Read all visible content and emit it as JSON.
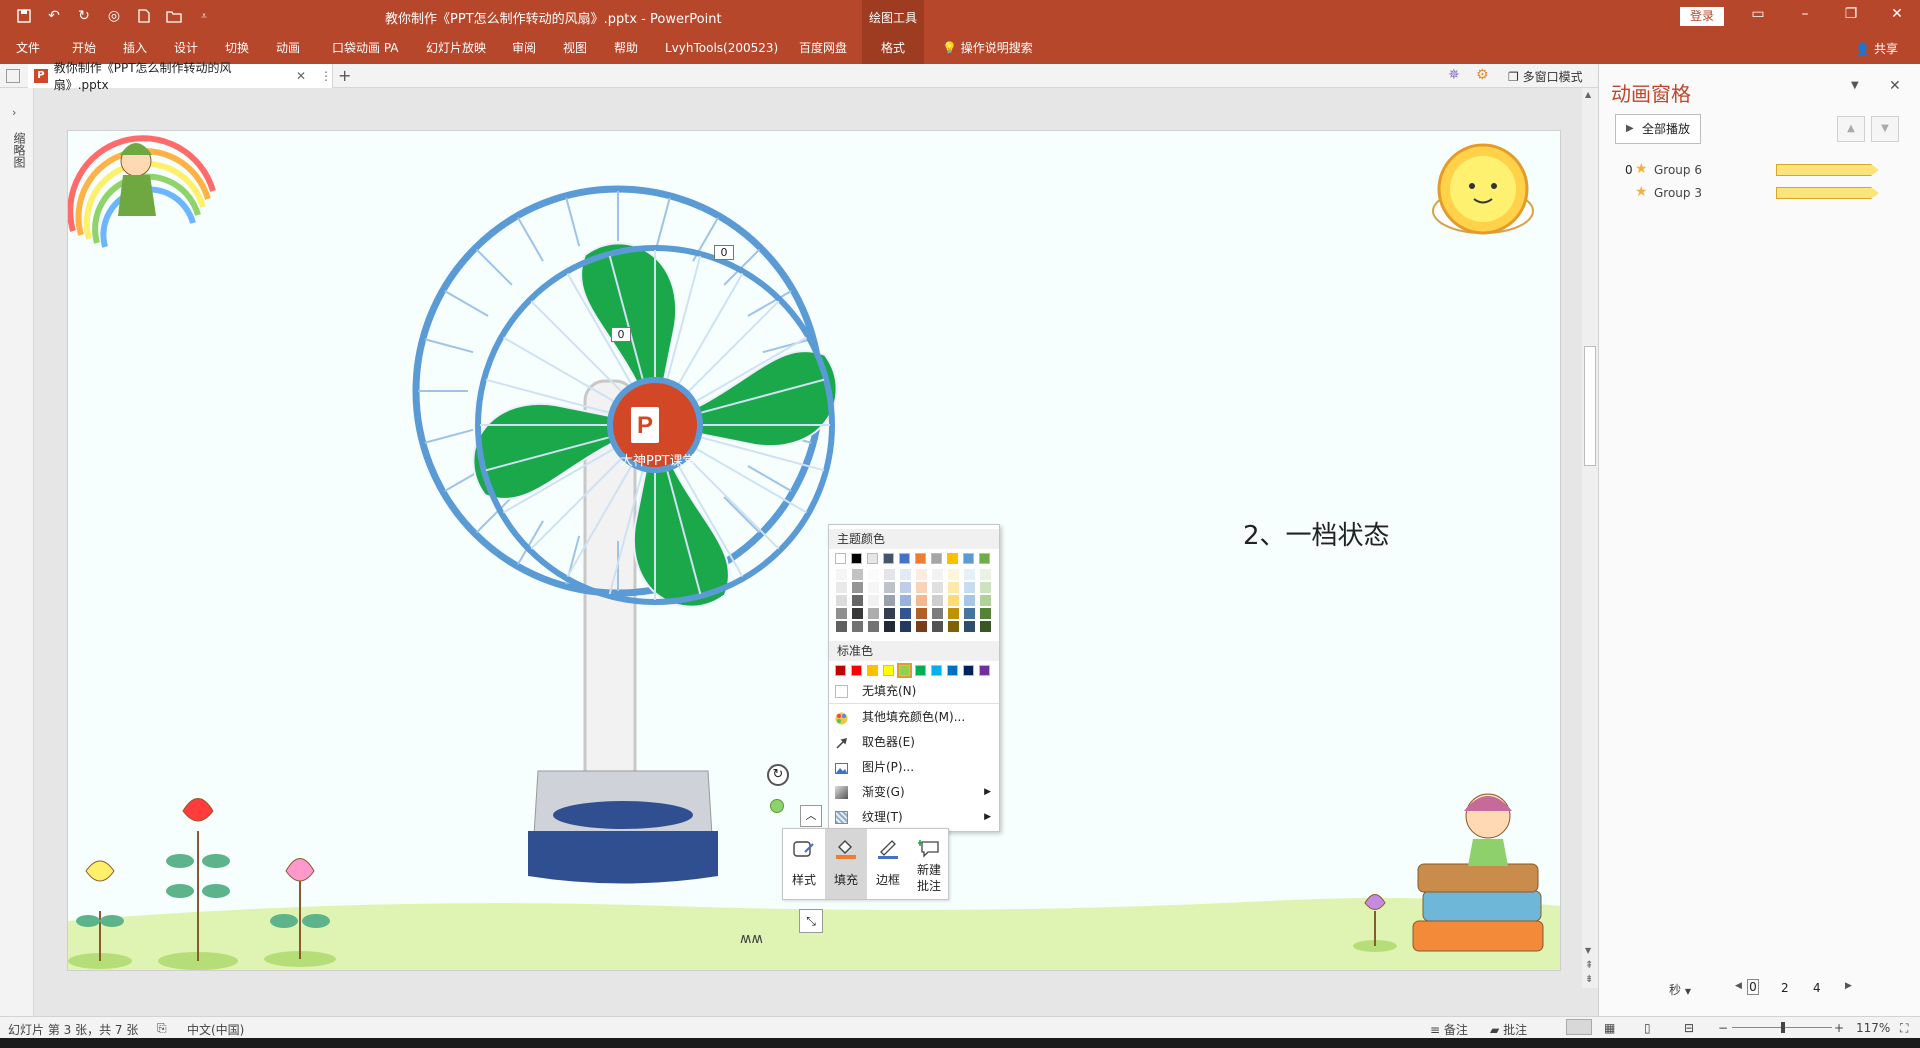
{
  "titlebar": {
    "title": "教你制作《PPT怎么制作转动的风扇》.pptx  -  PowerPoint",
    "drawing_tools": "绘图工具",
    "login": "登录"
  },
  "ribbon": {
    "tabs": [
      "文件",
      "开始",
      "插入",
      "设计",
      "切换",
      "动画",
      "口袋动画 PA",
      "幻灯片放映",
      "审阅",
      "视图",
      "帮助",
      "LvyhTools(200523)",
      "百度网盘",
      "格式"
    ],
    "tell_me": "操作说明搜索",
    "share": "共享"
  },
  "docbar": {
    "tab_label": "教你制作《PPT怎么制作转动的风扇》.pptx",
    "multi_window": "多窗口模式"
  },
  "leftstrip": {
    "label": "缩略图"
  },
  "slide": {
    "text": "2、一档状态",
    "marker_top": "0",
    "marker_left": "0",
    "logo_caption": "大神PPT课堂",
    "colors": {
      "blade": "#1aa84b",
      "rim": "#5b9bd5",
      "logo": "#d24726",
      "ground": "#dff3b2"
    }
  },
  "picker": {
    "theme_colors_label": "主题颜色",
    "theme_colors": [
      "#ffffff",
      "#000000",
      "#e7e6e6",
      "#44546a",
      "#4472c4",
      "#ed7d31",
      "#a5a5a5",
      "#ffc000",
      "#5b9bd5",
      "#70ad47"
    ],
    "standard_colors_label": "标准色",
    "standard_colors": [
      "#c00000",
      "#ff0000",
      "#ffc000",
      "#ffff00",
      "#92d050",
      "#00b050",
      "#00b0f0",
      "#0070c0",
      "#002060",
      "#7030a0"
    ],
    "no_fill": "无填充(N)",
    "more_colors": "其他填充颜色(M)...",
    "eyedropper": "取色器(E)",
    "picture": "图片(P)...",
    "gradient": "渐变(G)",
    "texture": "纹理(T)"
  },
  "minibar": {
    "style": "样式",
    "fill": "填充",
    "border": "边框",
    "new_comment_1": "新建",
    "new_comment_2": "批注"
  },
  "animpane": {
    "title": "动画窗格",
    "play_all": "全部播放",
    "items": [
      {
        "num": "0",
        "name": "Group 6"
      },
      {
        "num": "",
        "name": "Group 3"
      }
    ],
    "seconds": "秒",
    "scale": [
      "0",
      "2",
      "4"
    ]
  },
  "statusbar": {
    "slide_info": "幻灯片 第 3 张，共 7 张",
    "language": "中文(中国)",
    "notes": "备注",
    "comments": "批注",
    "zoom": "117%"
  }
}
